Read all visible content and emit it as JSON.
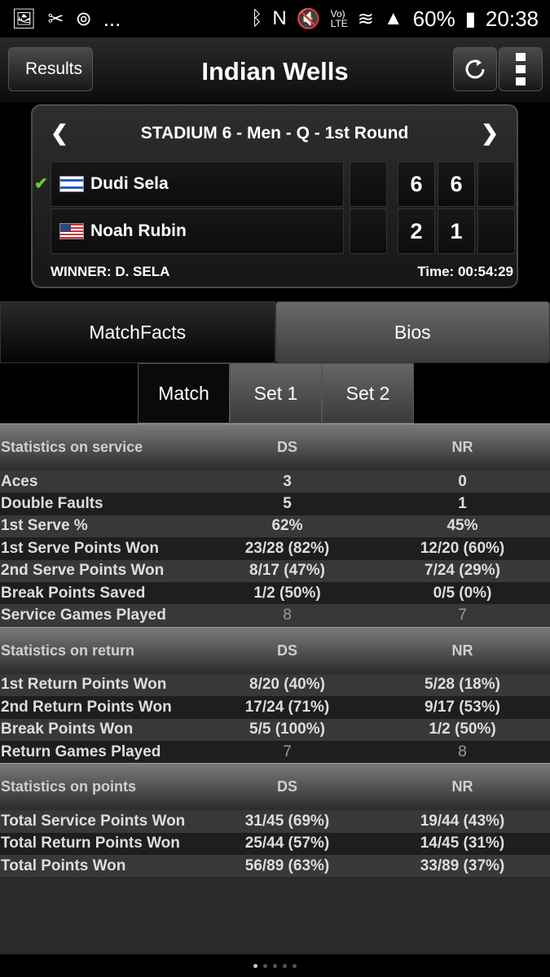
{
  "status_bar": {
    "battery": "60%",
    "time": "20:38",
    "dots": "..."
  },
  "nav": {
    "back_label": "Results",
    "title": "Indian Wells"
  },
  "match": {
    "court": "STADIUM 6 - Men - Q - 1st Round",
    "players": [
      {
        "name": "Dudi Sela",
        "flag": "IL",
        "sets": [
          "6",
          "6"
        ],
        "winner": true
      },
      {
        "name": "Noah Rubin",
        "flag": "US",
        "sets": [
          "2",
          "1"
        ],
        "winner": false
      }
    ],
    "winner_text": "WINNER: D. SELA",
    "time_text": "Time: 00:54:29"
  },
  "tabs": [
    {
      "label": "MatchFacts"
    },
    {
      "label": "Bios"
    }
  ],
  "segments": [
    {
      "label": "Match"
    },
    {
      "label": "Set 1"
    },
    {
      "label": "Set 2"
    }
  ],
  "stats": {
    "service": {
      "header": "Statistics on service",
      "col1": "DS",
      "col2": "NR",
      "rows": [
        {
          "label": "Aces",
          "ds": "3",
          "nr": "0"
        },
        {
          "label": "Double Faults",
          "ds": "5",
          "nr": "1"
        },
        {
          "label": "1st Serve %",
          "ds": "62%",
          "nr": "45%"
        },
        {
          "label": "1st Serve Points Won",
          "ds": "23/28 (82%)",
          "nr": "12/20 (60%)"
        },
        {
          "label": "2nd Serve Points Won",
          "ds": "8/17 (47%)",
          "nr": "7/24 (29%)"
        },
        {
          "label": "Break Points Saved",
          "ds": "1/2 (50%)",
          "nr": "0/5 (0%)"
        },
        {
          "label": "Service Games Played",
          "ds": "8",
          "nr": "7"
        }
      ]
    },
    "return": {
      "header": "Statistics on return",
      "col1": "DS",
      "col2": "NR",
      "rows": [
        {
          "label": "1st Return Points Won",
          "ds": "8/20 (40%)",
          "nr": "5/28 (18%)"
        },
        {
          "label": "2nd Return Points Won",
          "ds": "17/24 (71%)",
          "nr": "9/17 (53%)"
        },
        {
          "label": "Break Points Won",
          "ds": "5/5 (100%)",
          "nr": "1/2 (50%)"
        },
        {
          "label": "Return Games Played",
          "ds": "7",
          "nr": "8"
        }
      ]
    },
    "points": {
      "header": "Statistics on points",
      "col1": "DS",
      "col2": "NR",
      "rows": [
        {
          "label": "Total Service Points Won",
          "ds": "31/45 (69%)",
          "nr": "19/44 (43%)"
        },
        {
          "label": "Total Return Points Won",
          "ds": "25/44 (57%)",
          "nr": "14/45 (31%)"
        },
        {
          "label": "Total Points Won",
          "ds": "56/89 (63%)",
          "nr": "33/89 (37%)"
        }
      ]
    }
  },
  "colors": {
    "win_check": "#66cc33",
    "background": "#000000"
  }
}
